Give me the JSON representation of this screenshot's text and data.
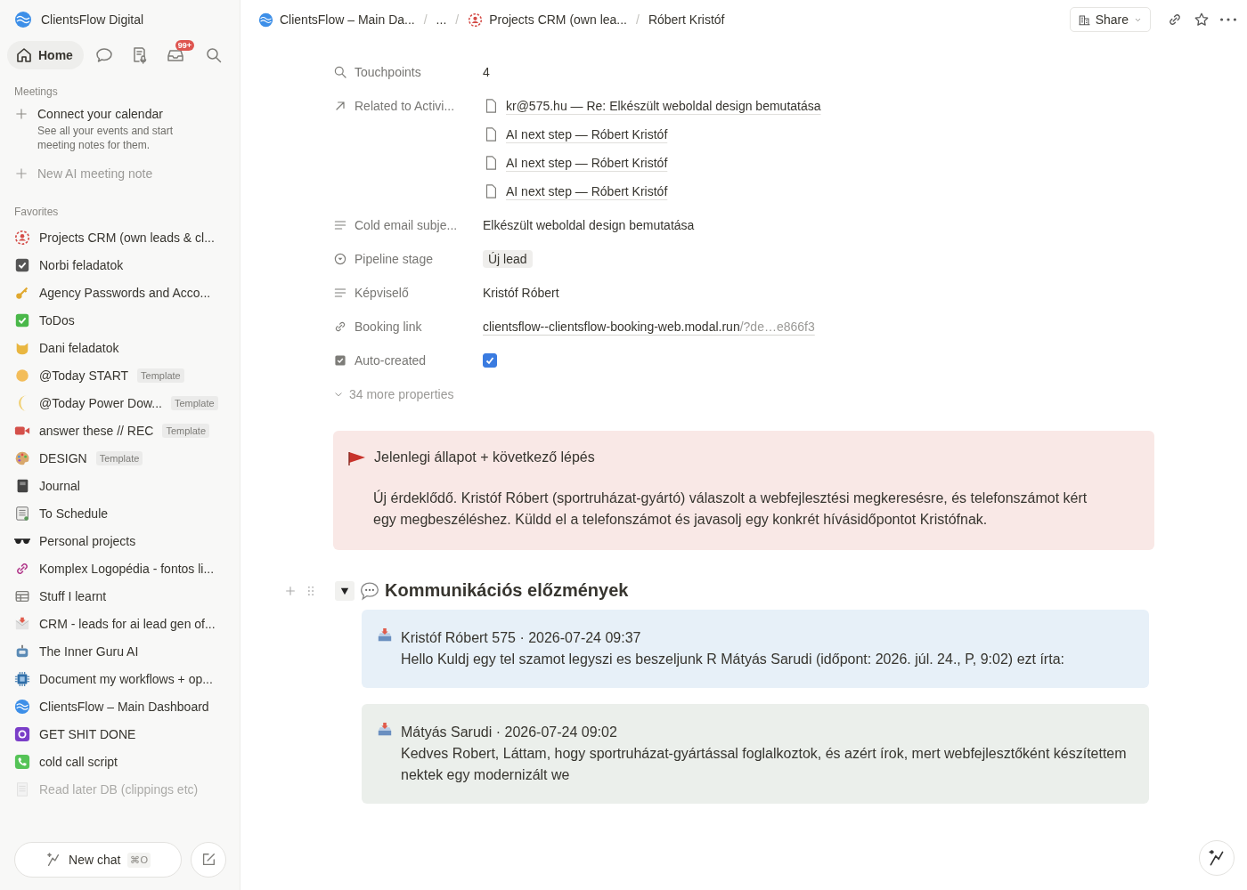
{
  "sidebar": {
    "workspace": "ClientsFlow Digital",
    "nav": [
      {
        "kind": "home",
        "label": "Home",
        "selected": true
      },
      {
        "kind": "chat",
        "selected": false
      },
      {
        "kind": "meetings",
        "selected": false
      },
      {
        "kind": "inbox",
        "badge": "99+",
        "selected": false
      },
      {
        "kind": "search",
        "selected": false
      }
    ],
    "meetings": {
      "heading": "Meetings",
      "connect_title": "Connect your calendar",
      "connect_description": "See all your events and start meeting notes for them.",
      "new_note": "New AI meeting note"
    },
    "favorites": {
      "heading": "Favorites",
      "items": [
        {
          "label": "Projects CRM (own leads & cl...",
          "faded": false
        },
        {
          "label": "Norbi feladatok",
          "faded": false
        },
        {
          "label": "Agency Passwords and Acco...",
          "faded": false
        },
        {
          "label": "ToDos",
          "faded": false
        },
        {
          "label": "Dani feladatok",
          "faded": false
        },
        {
          "label": "@Today START",
          "tag": "Template",
          "faded": false
        },
        {
          "label": "@Today Power Dow...",
          "tag": "Template",
          "faded": false
        },
        {
          "label": "answer these // REC",
          "tag": "Template",
          "faded": false
        },
        {
          "label": "DESIGN",
          "tag": "Template",
          "faded": false
        },
        {
          "label": "Journal",
          "faded": false
        },
        {
          "label": "To Schedule",
          "faded": false
        },
        {
          "label": "Personal projects",
          "faded": false
        },
        {
          "label": "Komplex Logopédia - fontos li...",
          "faded": false
        },
        {
          "label": "Stuff I learnt",
          "faded": false
        },
        {
          "label": "CRM - leads for ai lead gen of...",
          "faded": false
        },
        {
          "label": "The Inner Guru AI",
          "faded": false
        },
        {
          "label": "Document my workflows + op...",
          "faded": false
        },
        {
          "label": "ClientsFlow – Main Dashboard",
          "faded": false
        },
        {
          "label": "GET SHIT DONE",
          "faded": false
        },
        {
          "label": "cold call script",
          "faded": false
        },
        {
          "label": "Read later DB (clippings etc)",
          "faded": true
        }
      ]
    },
    "new_chat": {
      "label": "New chat",
      "shortcut": "⌘O"
    }
  },
  "breadcrumb_separator": "/",
  "breadcrumb": [
    "ClientsFlow – Main Da...",
    "...",
    "Projects CRM (own lea...",
    "Róbert Kristóf"
  ],
  "share": "Share",
  "properties": [
    {
      "kind": "text",
      "label": "Touchpoints",
      "value": "4"
    },
    {
      "kind": "relations",
      "label": "Related to Activi...",
      "values": [
        "kr@575.hu — Re: Elkészült weboldal design bemutatása",
        "AI next step — Róbert Kristóf",
        "AI next step — Róbert Kristóf",
        "AI next step — Róbert Kristóf"
      ]
    },
    {
      "kind": "text",
      "label": "Cold email subje...",
      "value": "Elkészült weboldal design bemutatása"
    },
    {
      "kind": "tag",
      "label": "Pipeline stage",
      "value": "Új lead"
    },
    {
      "kind": "text",
      "label": "Képviselő",
      "value": "Kristóf Róbert"
    },
    {
      "kind": "link",
      "label": "Booking link",
      "value": "clientsflow--clientsflow-booking-web.modal.run",
      "suffix": "/?de…e866f3"
    },
    {
      "kind": "checkbox",
      "label": "Auto-created",
      "checked": true
    }
  ],
  "more_properties": "34 more properties",
  "callout": {
    "title": "Jelenlegi állapot + következő lépés",
    "body": "Új érdeklődő. Kristóf Róbert (sportruházat-gyártó) válaszolt a webfejlesztési megkeresésre, és telefonszámot kért egy megbeszéléshez. Küldd el a telefonszámot és javasolj egy konkrét hívásidőpontot Kristófnak."
  },
  "section": {
    "title": "Kommunikációs előzmények",
    "expanded": true,
    "messages": [
      {
        "header": "Kristóf Róbert 575 · 2026-07-24 09:37",
        "body": "Hello Kuldj egy tel szamot legyszi es beszeljunk R Mátyás Sarudi (időpont: 2026. júl. 24., P, 9:02) ezt írta:",
        "color": "#e7f0f8"
      },
      {
        "header": "Mátyás Sarudi · 2026-07-24 09:02",
        "body": "Kedves Robert, Láttam, hogy sportruházat-gyártással foglalkoztok, és azért írok, mert webfejlesztőként készítettem nektek egy modernizált we",
        "color": "#ebefeb"
      }
    ]
  }
}
